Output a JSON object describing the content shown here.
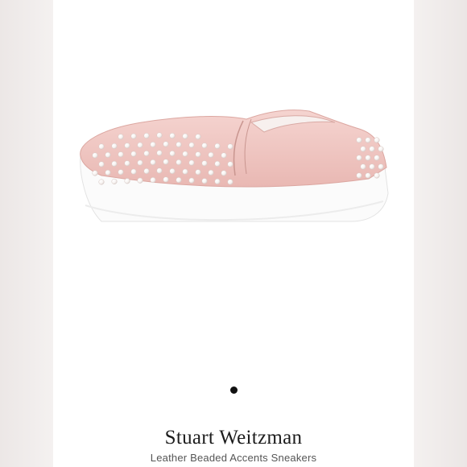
{
  "listing": {
    "brand": "Stuart Weitzman",
    "product_name": "Leather Beaded Accents Sneakers",
    "image_subject": "pink leather slip-on sneaker with pearl bead accents",
    "carousel_dots": 1
  },
  "colors": {
    "shoe_pink": "#f1c6c2",
    "sole_white": "#fbfbfb",
    "pearl": "#ffffff"
  }
}
